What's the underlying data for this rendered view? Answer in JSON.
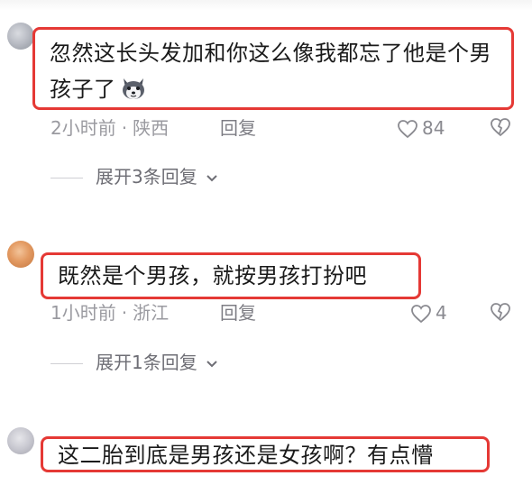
{
  "comments": [
    {
      "text": "忽然这长头发加和你这么像我都忘了他是个男孩子了",
      "emoji": "husky-dog-emoji",
      "time": "2小时前",
      "location": "陕西",
      "reply_label": "回复",
      "likes": "84",
      "replies_label": "展开3条回复"
    },
    {
      "text": "既然是个男孩，就按男孩打扮吧",
      "time": "1小时前",
      "location": "浙江",
      "reply_label": "回复",
      "likes": "4",
      "replies_label": "展开1条回复"
    },
    {
      "text": "这二胎到底是男孩还是女孩啊？有点懵"
    }
  ],
  "separator": "·",
  "colors": {
    "highlight_border": "#e53935",
    "meta_text": "#9a9aa0",
    "body_text": "#1a1a1a"
  },
  "icons": {
    "like": "heart-outline-icon",
    "dislike": "broken-heart-icon",
    "expand": "chevron-down-icon"
  }
}
